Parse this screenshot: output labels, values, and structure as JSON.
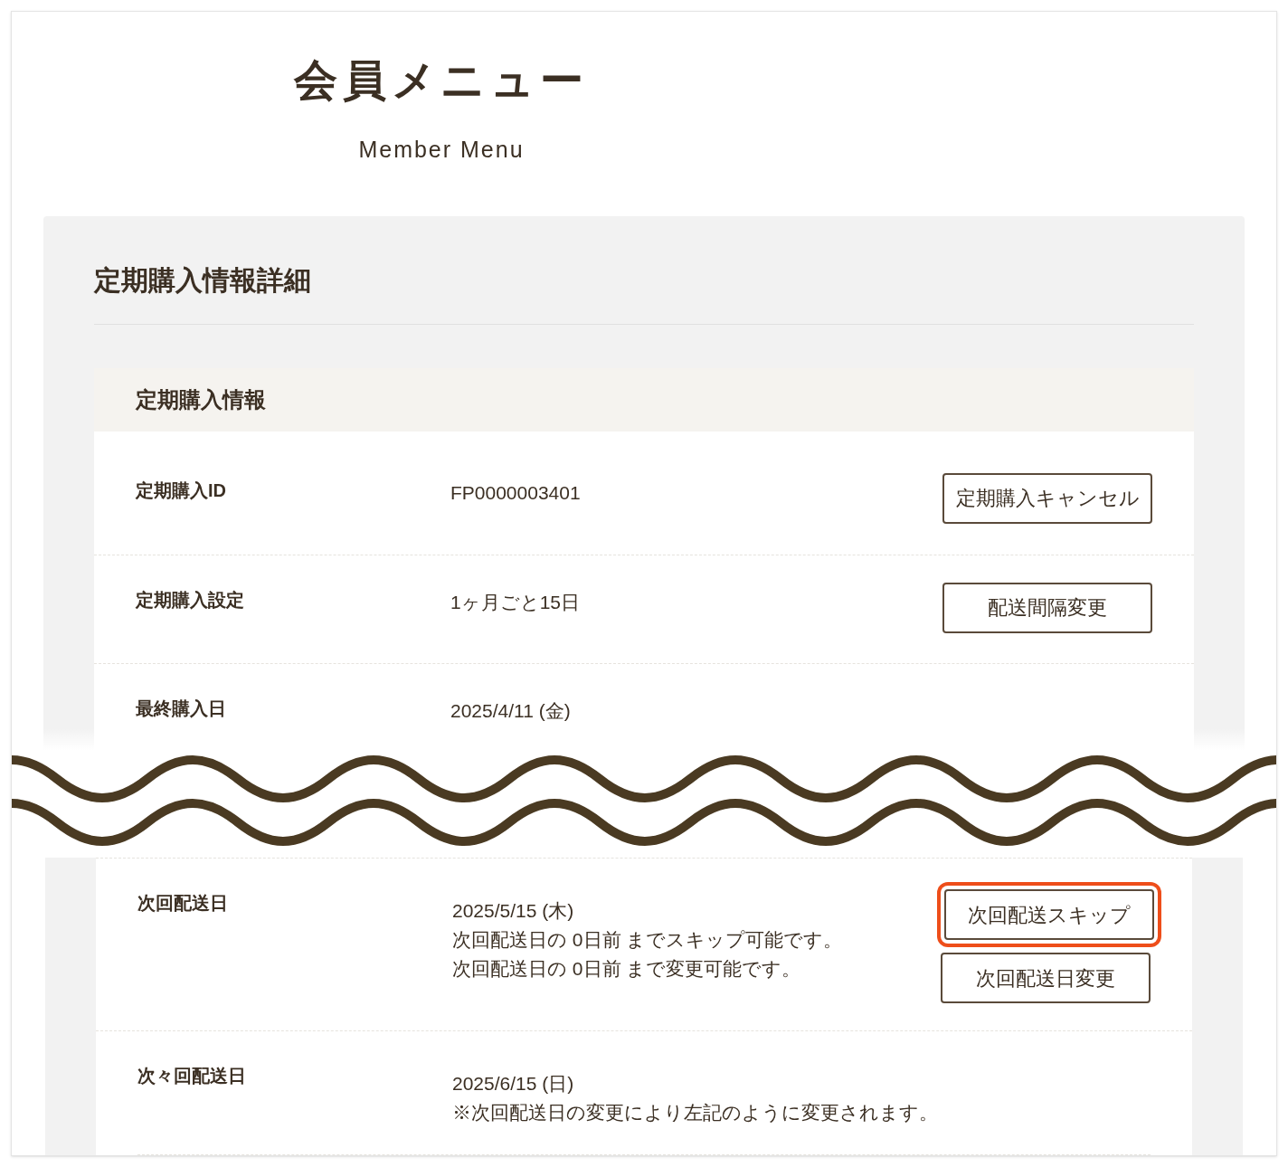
{
  "page": {
    "title": "会員メニュー",
    "subtitle": "Member Menu"
  },
  "panel": {
    "title": "定期購入情報詳細",
    "card": {
      "title": "定期購入情報",
      "rows_before_cut": [
        {
          "label": "定期購入ID",
          "lines": [
            "FP0000003401"
          ],
          "buttons": [
            {
              "label": "定期購入キャンセル",
              "highlighted": false
            }
          ]
        },
        {
          "label": "定期購入設定",
          "lines": [
            "1ヶ月ごと15日"
          ],
          "buttons": [
            {
              "label": "配送間隔変更",
              "highlighted": false
            }
          ]
        },
        {
          "label": "最終購入日",
          "lines": [
            "2025/4/11 (金)"
          ]
        }
      ],
      "rows_after_cut": [
        {
          "label": "次回配送日",
          "lines": [
            "2025/5/15 (木)",
            "次回配送日の 0日前 までスキップ可能です。",
            "次回配送日の 0日前 まで変更可能です。"
          ],
          "buttons": [
            {
              "label": "次回配送スキップ",
              "highlighted": true
            },
            {
              "label": "次回配送日変更",
              "highlighted": false
            }
          ]
        },
        {
          "label": "次々回配送日",
          "lines": [
            "2025/6/15 (日)",
            "※次回配送日の変更により左記のように変更されます。"
          ]
        }
      ]
    }
  }
}
